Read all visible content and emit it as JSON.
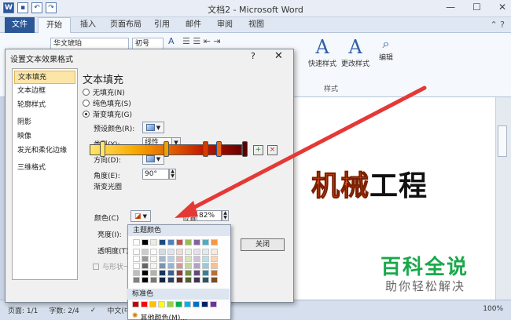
{
  "window": {
    "title": "文档2 - Microsoft Word",
    "minimize": "—",
    "maximize": "☐",
    "close": "✕"
  },
  "tabs": [
    "文件",
    "开始",
    "插入",
    "页面布局",
    "引用",
    "邮件",
    "审阅",
    "视图"
  ],
  "ribbon": {
    "font_name": "华文琥珀",
    "font_size": "初号",
    "quick_styles": "快速样式",
    "change_styles": "更改样式",
    "edit": "编辑",
    "styles_group": "样式"
  },
  "dialog": {
    "title": "设置文本效果格式",
    "help": "?",
    "close_x": "✕",
    "nav": [
      "文本填充",
      "文本边框",
      "轮廓样式",
      "阴影",
      "映像",
      "发光和柔化边缘",
      "三维格式"
    ],
    "nav_selected": 0,
    "section_title": "文本填充",
    "fill_options": [
      "无填充(N)",
      "纯色填充(S)",
      "渐变填充(G)"
    ],
    "fill_selected": 2,
    "preset_label": "预设颜色(R):",
    "type_label": "类型(Y):",
    "type_value": "线性",
    "direction_label": "方向(D):",
    "angle_label": "角度(E):",
    "angle_value": "90°",
    "stops_label": "渐变光圈",
    "color_label": "颜色(C)",
    "position_label": "位置(O):",
    "position_value": "82%",
    "brightness_label": "亮度(I):",
    "transparency_label": "透明度(T):",
    "rotate_label": "与形状一",
    "close_button": "关闭"
  },
  "color_popup": {
    "theme_title": "主题颜色",
    "standard_title": "标准色",
    "more_colors": "其他颜色(M)...",
    "theme_top": [
      "#ffffff",
      "#000000",
      "#eeece1",
      "#1f497d",
      "#4f81bd",
      "#c0504d",
      "#9bbb59",
      "#8064a2",
      "#4bacc6",
      "#f79646"
    ],
    "standard": [
      "#c00000",
      "#ff0000",
      "#ffc000",
      "#ffff00",
      "#92d050",
      "#00b050",
      "#00b0f0",
      "#0070c0",
      "#002060",
      "#7030a0"
    ]
  },
  "document": {
    "heading_highlight": "机械",
    "heading_rest": "工程",
    "watermark_title": "百科全说",
    "watermark_sub": "助你轻松解决"
  },
  "status": {
    "page": "页面: 1/1",
    "words": "字数: 2/4",
    "lang": "中文(中",
    "zoom": "100%"
  },
  "colors": {
    "accent": "#2b5797",
    "arrow": "#e53935"
  }
}
